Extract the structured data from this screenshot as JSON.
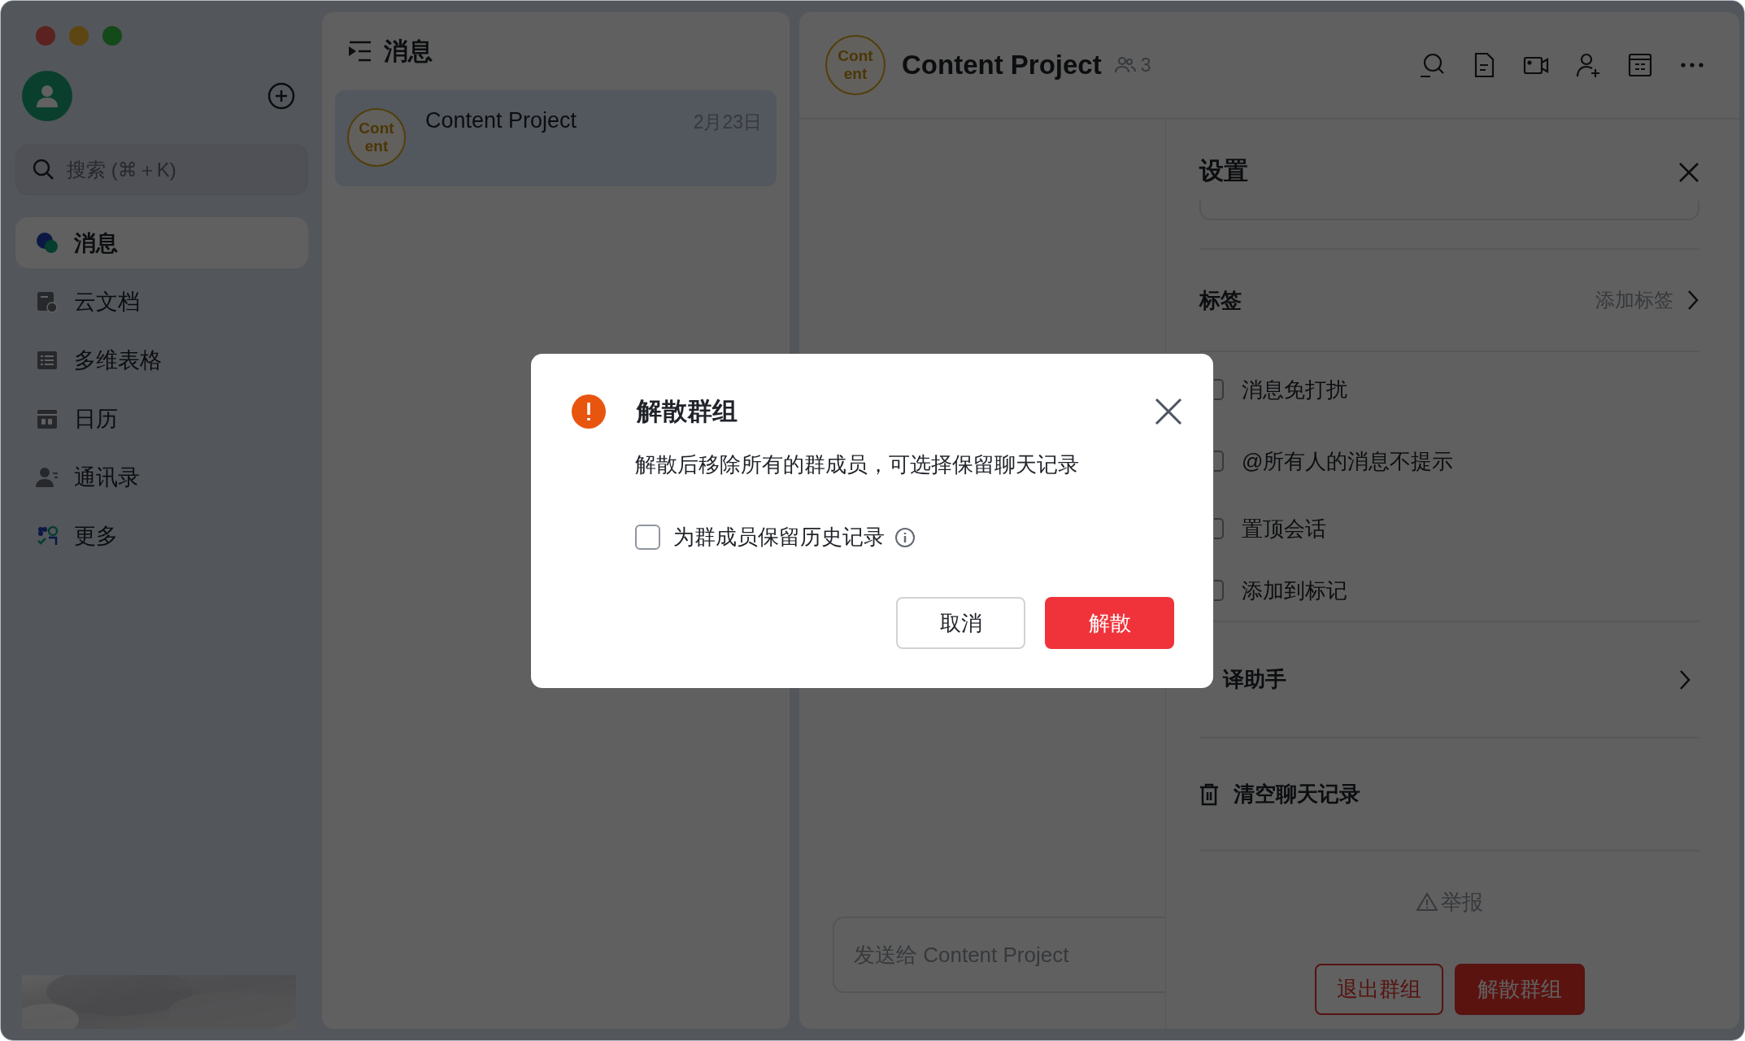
{
  "sidebar": {
    "search": {
      "placeholder": "搜索 (⌘＋K)"
    },
    "nav": [
      {
        "label": "消息",
        "kind": "chat",
        "selected": true
      },
      {
        "label": "云文档",
        "kind": "docs",
        "selected": false
      },
      {
        "label": "多维表格",
        "kind": "table",
        "selected": false
      },
      {
        "label": "日历",
        "kind": "calendar",
        "selected": false
      },
      {
        "label": "通讯录",
        "kind": "contacts",
        "selected": false
      },
      {
        "label": "更多",
        "kind": "apps",
        "selected": false
      }
    ]
  },
  "chat_list": {
    "title": "消息",
    "items": [
      {
        "avatar_lines": [
          "Cont",
          "ent"
        ],
        "name": "Content Project",
        "date": "2月23日",
        "selected": true
      }
    ]
  },
  "chat": {
    "avatar_lines": [
      "Cont",
      "ent"
    ],
    "title": "Content Project",
    "member_count": "3",
    "input": {
      "placeholder": "发送给 Content Project"
    }
  },
  "settings": {
    "title": "设置",
    "tags": {
      "label": "标签",
      "action": "添加标签"
    },
    "options": [
      {
        "label": "消息免打扰",
        "checked": false
      },
      {
        "label": "@所有人的消息不提示",
        "checked": false
      },
      {
        "label": "置顶会话",
        "checked": false
      },
      {
        "label": "添加到标记",
        "checked": false
      }
    ],
    "translator": {
      "label": "译助手"
    },
    "clear_history": "清空聊天记录",
    "report": "举报",
    "buttons": [
      {
        "label": "退出群组",
        "kind": "outline"
      },
      {
        "label": "解散群组",
        "kind": "danger"
      }
    ]
  },
  "dialog": {
    "title": "解散群组",
    "message": "解散后移除所有的群成员，可选择保留聊天记录",
    "option": {
      "label": "为群成员保留历史记录",
      "checked": false
    },
    "buttons": [
      {
        "label": "取消",
        "kind": "secondary"
      },
      {
        "label": "解散",
        "kind": "primary"
      }
    ]
  }
}
